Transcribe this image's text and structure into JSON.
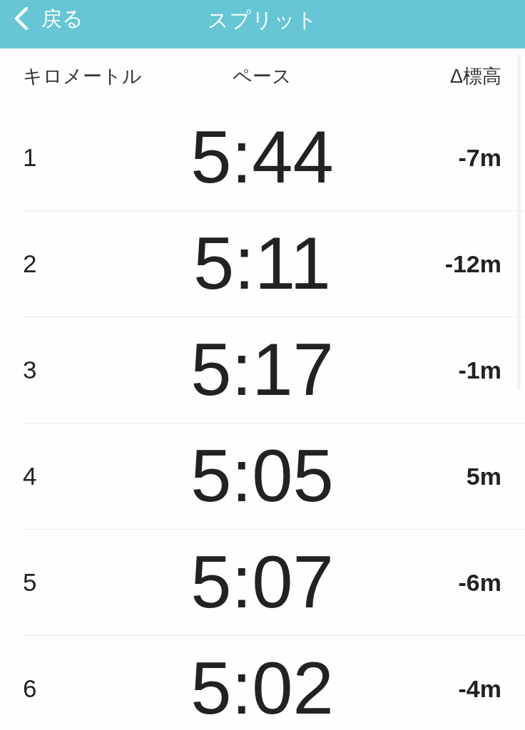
{
  "nav_bar": {
    "back_button": {
      "label": "戻る"
    },
    "title": "スプリット"
  },
  "table": {
    "columns": [
      "キロメートル",
      "ペース",
      "Δ標高"
    ],
    "rows": [
      {
        "km": "1",
        "pace": "5:44",
        "elevation": "-7m"
      },
      {
        "km": "2",
        "pace": "5:11",
        "elevation": "-12m"
      },
      {
        "km": "3",
        "pace": "5:17",
        "elevation": "-1m"
      },
      {
        "km": "4",
        "pace": "5:05",
        "elevation": "5m"
      },
      {
        "km": "5",
        "pace": "5:07",
        "elevation": "-6m"
      },
      {
        "km": "6",
        "pace": "5:02",
        "elevation": "-4m"
      }
    ]
  }
}
